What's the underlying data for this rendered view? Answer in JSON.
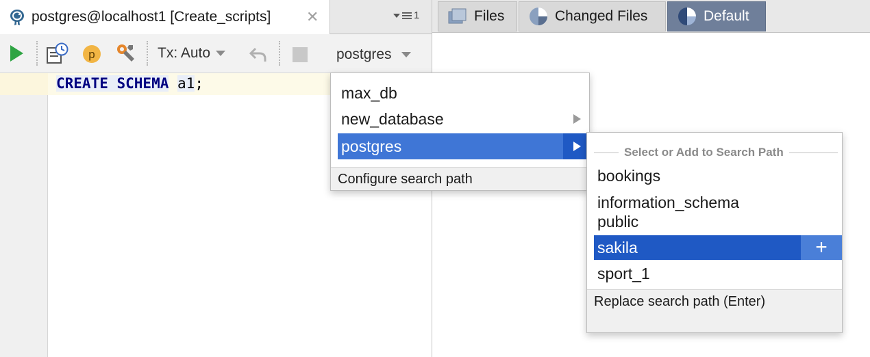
{
  "editor_tab": {
    "title": "postgres@localhost1 [Create_scripts]",
    "close_glyph": "✕",
    "icon": "postgresql-elephant-icon"
  },
  "tab_overflow": {
    "count": "1",
    "icon": "tab-list-icon"
  },
  "toolbar": {
    "run_icon": "run-icon",
    "history_icon": "query-history-icon",
    "profile_icon": "profile-icon",
    "profile_letter": "p",
    "settings_icon": "settings-wrench-icon",
    "tx_label": "Tx: Auto",
    "undo_icon": "rollback-icon",
    "stop_icon": "stop-icon",
    "schema_value": "postgres"
  },
  "editor": {
    "keyword": "CREATE SCHEMA",
    "identifier": "a1",
    "terminator": ";"
  },
  "right_tabs": [
    {
      "label": "Files",
      "icon": "files-icon"
    },
    {
      "label": "Changed Files",
      "icon": "pie-chart-icon"
    },
    {
      "label": "Default",
      "icon": "pie-chart-icon"
    }
  ],
  "db_popup": {
    "items": [
      {
        "label": "max_db"
      },
      {
        "label": "new_database"
      },
      {
        "label": "postgres"
      }
    ],
    "selected": "postgres",
    "footer": "Configure search path"
  },
  "search_path_popup": {
    "header": "Select or Add to Search Path",
    "items": [
      {
        "label": "bookings"
      },
      {
        "label": "information_schema"
      },
      {
        "label": "public"
      },
      {
        "label": "sakila"
      },
      {
        "label": "sport_1"
      }
    ],
    "selected": "sakila",
    "add_glyph": "+",
    "footer": "Replace search path (Enter)"
  },
  "colors": {
    "selection": "#1f59c4",
    "selection_light": "#3f76d6",
    "keyword": "#000080",
    "active_tab": "#6f7f9a"
  }
}
